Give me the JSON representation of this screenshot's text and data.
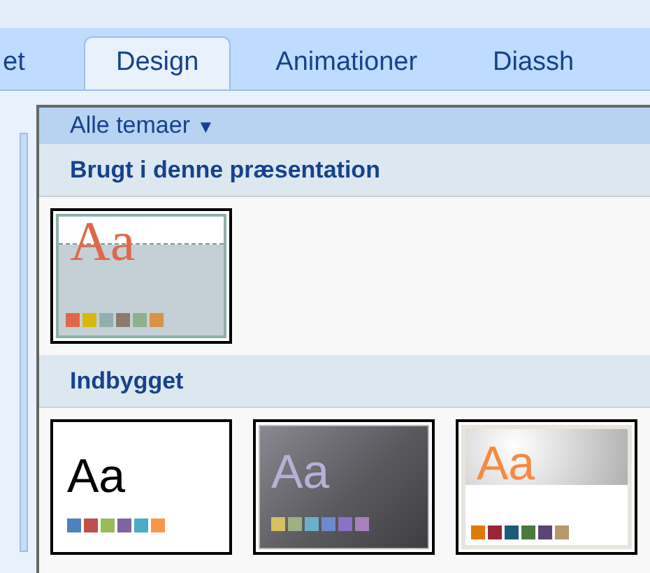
{
  "tabs": [
    {
      "label": "et",
      "selected": false
    },
    {
      "label": "Design",
      "selected": true
    },
    {
      "label": "Animationer",
      "selected": false
    },
    {
      "label": "Diassh",
      "selected": false
    }
  ],
  "gallery": {
    "filter": "Alle temaer",
    "filter_caret": "▼",
    "sections": [
      {
        "title": "Brugt i denne præsentation",
        "themes": [
          {
            "kind": "flow",
            "sample": "Aa",
            "swatches": [
              {
                "color": "#e0684a"
              },
              {
                "color": "#d6b90c"
              },
              {
                "color": "#8fb0ad"
              },
              {
                "color": "#8c7a6e"
              },
              {
                "color": "#8fb08a"
              },
              {
                "color": "#d9924a"
              }
            ]
          }
        ]
      },
      {
        "title": "Indbygget",
        "themes": [
          {
            "kind": "office",
            "sample": "Aa",
            "swatches": [
              {
                "color": "#4f81bd"
              },
              {
                "color": "#c0504d"
              },
              {
                "color": "#9bbb59"
              },
              {
                "color": "#8064a2"
              },
              {
                "color": "#4bacc6"
              },
              {
                "color": "#f79646"
              }
            ]
          },
          {
            "kind": "dark",
            "sample": "Aa",
            "swatches": [
              {
                "color": "#d6c060"
              },
              {
                "color": "#9cb084"
              },
              {
                "color": "#6ab0c8"
              },
              {
                "color": "#6c8ad0"
              },
              {
                "color": "#8a72c8"
              },
              {
                "color": "#a880c0"
              }
            ]
          },
          {
            "kind": "gradient",
            "sample": "Aa",
            "swatches": [
              {
                "color": "#e0780a"
              },
              {
                "color": "#9a2536"
              },
              {
                "color": "#1e5a7a"
              },
              {
                "color": "#4a7a3c"
              },
              {
                "color": "#5a4478"
              },
              {
                "color": "#b89868"
              }
            ]
          }
        ]
      }
    ]
  }
}
